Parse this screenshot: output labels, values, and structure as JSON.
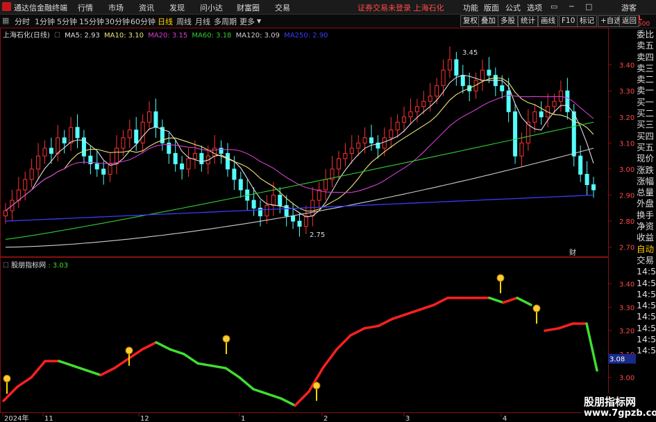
{
  "menubar": {
    "app_title": "通达信金融终端",
    "menus": [
      "行情",
      "市场",
      "资讯",
      "发现",
      "问小达",
      "财富圈",
      "交易"
    ],
    "warning": "证券交易未登录  上海石化",
    "right_menus": [
      "功能",
      "版面",
      "公式",
      "选项"
    ],
    "guest": "游客"
  },
  "toolbar": {
    "periods": [
      "分时",
      "1分钟",
      "5分钟",
      "15分钟",
      "30分钟",
      "60分钟",
      "日线",
      "周线",
      "月线",
      "多周期",
      "更多"
    ],
    "active_period": "日线",
    "right_buttons": [
      "复权",
      "叠加",
      "多股",
      "统计",
      "画线",
      "F10",
      "标记",
      "+自选",
      "返回"
    ]
  },
  "lmark": {
    "l": "L",
    "num": "500"
  },
  "legend": {
    "title": "上海石化(日线)",
    "items": [
      {
        "label": "MA5: 2.93",
        "color": "#e0e0e0"
      },
      {
        "label": "MA10: 3.10",
        "color": "#f3e67a"
      },
      {
        "label": "MA20: 3.15",
        "color": "#d43fd4"
      },
      {
        "label": "MA60: 3.18",
        "color": "#33cc33"
      },
      {
        "label": "MA120: 3.09",
        "color": "#cfcfcf"
      },
      {
        "label": "MA250: 2.90",
        "color": "#3b3bff"
      }
    ]
  },
  "sub_legend": {
    "name": "股朋指标网",
    "value": ": 3.03"
  },
  "price_labels": {
    "high": "3.45",
    "low": "2.75",
    "cai": "财"
  },
  "main_axis": [
    "3.40",
    "3.30",
    "3.20",
    "3.10",
    "3.00",
    "2.90",
    "2.80",
    "2.70"
  ],
  "sub_axis": [
    "3.40",
    "3.30",
    "3.20",
    "3.10",
    "3.00",
    "2.90"
  ],
  "current_tag": "3.08",
  "side_panel": [
    "L 500",
    "委比",
    "卖五",
    "卖四",
    "卖三",
    "卖二",
    "卖一",
    "买一",
    "买二",
    "买三",
    "买四",
    "买五",
    "现价",
    "涨跌",
    "涨幅",
    "总量",
    "外盘",
    "换手",
    "净资",
    "收益",
    "自动",
    "交易",
    "14:56",
    "14:56",
    "14:56",
    "14:56",
    "14:56",
    "14:56",
    "14:56",
    "14:56"
  ],
  "date_axis": [
    "2024年",
    "11",
    "12",
    "1",
    "2",
    "3",
    "4"
  ],
  "watermark": {
    "line1": "股朋指标网",
    "line2": "www.7gpzb.com"
  },
  "colors": {
    "up": "#ff3232",
    "down": "#54ffff",
    "green": "#40dd30",
    "bg": "#000000"
  },
  "chart_data": [
    {
      "type": "candlestick",
      "title": "上海石化(日线)",
      "xlabel": "",
      "ylabel": "",
      "ylim": [
        2.67,
        3.5
      ],
      "scale": "linear",
      "grid": false,
      "x": [
        "2024-10",
        "2024-11",
        "2024-12",
        "2025-01",
        "2025-02",
        "2025-03",
        "2025-04"
      ],
      "series": [
        {
          "name": "MA5",
          "values": [
            2.93
          ]
        },
        {
          "name": "MA10",
          "values": [
            3.1
          ]
        },
        {
          "name": "MA20",
          "values": [
            3.15
          ]
        },
        {
          "name": "MA60",
          "values": [
            3.18
          ]
        },
        {
          "name": "MA120",
          "values": [
            3.09
          ]
        },
        {
          "name": "MA250",
          "values": [
            2.9
          ]
        }
      ],
      "close": [
        2.84,
        2.88,
        2.92,
        2.96,
        3.0,
        3.05,
        3.08,
        3.06,
        3.12,
        3.1,
        3.16,
        3.12,
        3.05,
        3.02,
        3.0,
        2.98,
        3.02,
        3.08,
        3.12,
        3.15,
        3.1,
        3.18,
        3.22,
        3.16,
        3.1,
        3.06,
        3.02,
        3.0,
        3.04,
        3.06,
        3.02,
        3.05,
        3.08,
        3.06,
        3.0,
        2.96,
        2.92,
        2.88,
        2.85,
        2.82,
        2.86,
        2.9,
        2.86,
        2.82,
        2.8,
        2.78,
        2.82,
        2.88,
        2.92,
        2.96,
        3.0,
        3.04,
        3.06,
        3.08,
        3.1,
        3.12,
        3.1,
        3.08,
        3.12,
        3.15,
        3.18,
        3.2,
        3.22,
        3.24,
        3.26,
        3.28,
        3.32,
        3.38,
        3.42,
        3.36,
        3.32,
        3.3,
        3.34,
        3.38,
        3.36,
        3.32,
        3.3,
        3.22,
        3.05,
        3.1,
        3.18,
        3.22,
        3.2,
        3.24,
        3.26,
        3.3,
        3.22,
        3.05,
        2.98,
        2.94,
        2.92
      ],
      "annotations": {
        "high": 3.45,
        "low": 2.75
      }
    },
    {
      "type": "line",
      "title": "股朋指标网",
      "xlabel": "",
      "ylabel": "",
      "ylim": [
        2.86,
        3.47
      ],
      "value": 3.03,
      "current": 3.08,
      "series": [
        {
          "name": "股朋指标网",
          "x": [
            0,
            20,
            40,
            60,
            80,
            100,
            120,
            140,
            160,
            180,
            200,
            220,
            240,
            260,
            280,
            300,
            320,
            340,
            360,
            380,
            400,
            420,
            440,
            460,
            480,
            500,
            520,
            540,
            560,
            580,
            600,
            620,
            640,
            660,
            680,
            700,
            720,
            740,
            760,
            780,
            800,
            820,
            840,
            855
          ],
          "values": [
            2.9,
            2.96,
            3.0,
            3.07,
            3.07,
            3.05,
            3.03,
            3.01,
            3.04,
            3.08,
            3.12,
            3.15,
            3.12,
            3.1,
            3.06,
            3.05,
            3.04,
            3.0,
            2.95,
            2.93,
            2.91,
            2.88,
            2.94,
            3.04,
            3.12,
            3.18,
            3.21,
            3.22,
            3.25,
            3.27,
            3.29,
            3.31,
            3.34,
            3.34,
            3.34,
            3.34,
            3.32,
            3.34,
            3.31,
            3.2,
            3.21,
            3.23,
            3.23,
            3.03
          ]
        }
      ]
    }
  ]
}
